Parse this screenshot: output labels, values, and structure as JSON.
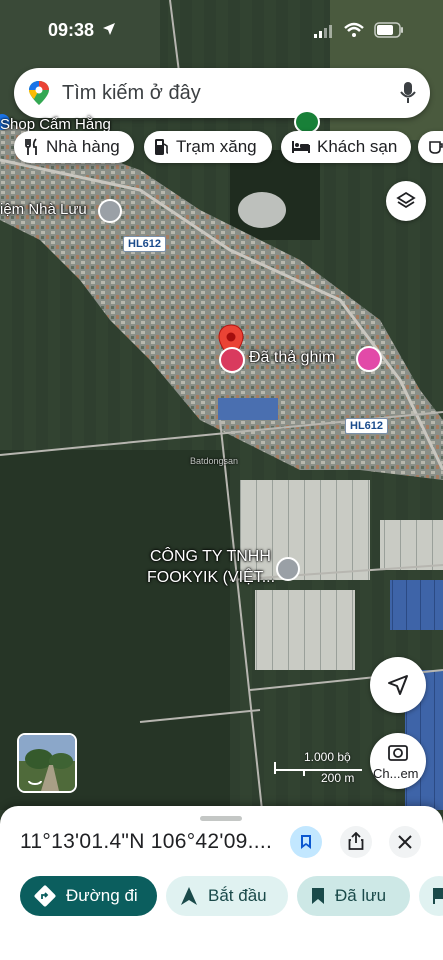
{
  "status": {
    "time": "09:38"
  },
  "search": {
    "placeholder": "Tìm kiếm ở đây"
  },
  "chips": [
    {
      "label": "Nhà hàng",
      "icon": "utensils-icon"
    },
    {
      "label": "Trạm xăng",
      "icon": "gas-pump-icon"
    },
    {
      "label": "Khách sạn",
      "icon": "bed-icon"
    }
  ],
  "map": {
    "shop_label": "Shop Cẩm Hằng",
    "place_nha_luu": "iệm Nhà Lưu",
    "road_hl612_a": "HL612",
    "road_hl612_b": "HL612",
    "dropped_pin": "Đã thả ghim",
    "company_line1": "CÔNG TY TNHH",
    "company_line2": "FOOKYIK (VIỆT...",
    "watermark": "Batdongsan",
    "scale_top": "1.000 bộ",
    "scale_bottom": "200 m",
    "share_label": "Ch...em"
  },
  "sheet": {
    "coords": "11°13'01.4\"N 106°42'09....",
    "actions": [
      {
        "label": "Đường đi",
        "icon": "directions-icon"
      },
      {
        "label": "Bắt đầu",
        "icon": "navigation-arrow-icon"
      },
      {
        "label": "Đã lưu",
        "icon": "bookmark-icon"
      }
    ]
  }
}
